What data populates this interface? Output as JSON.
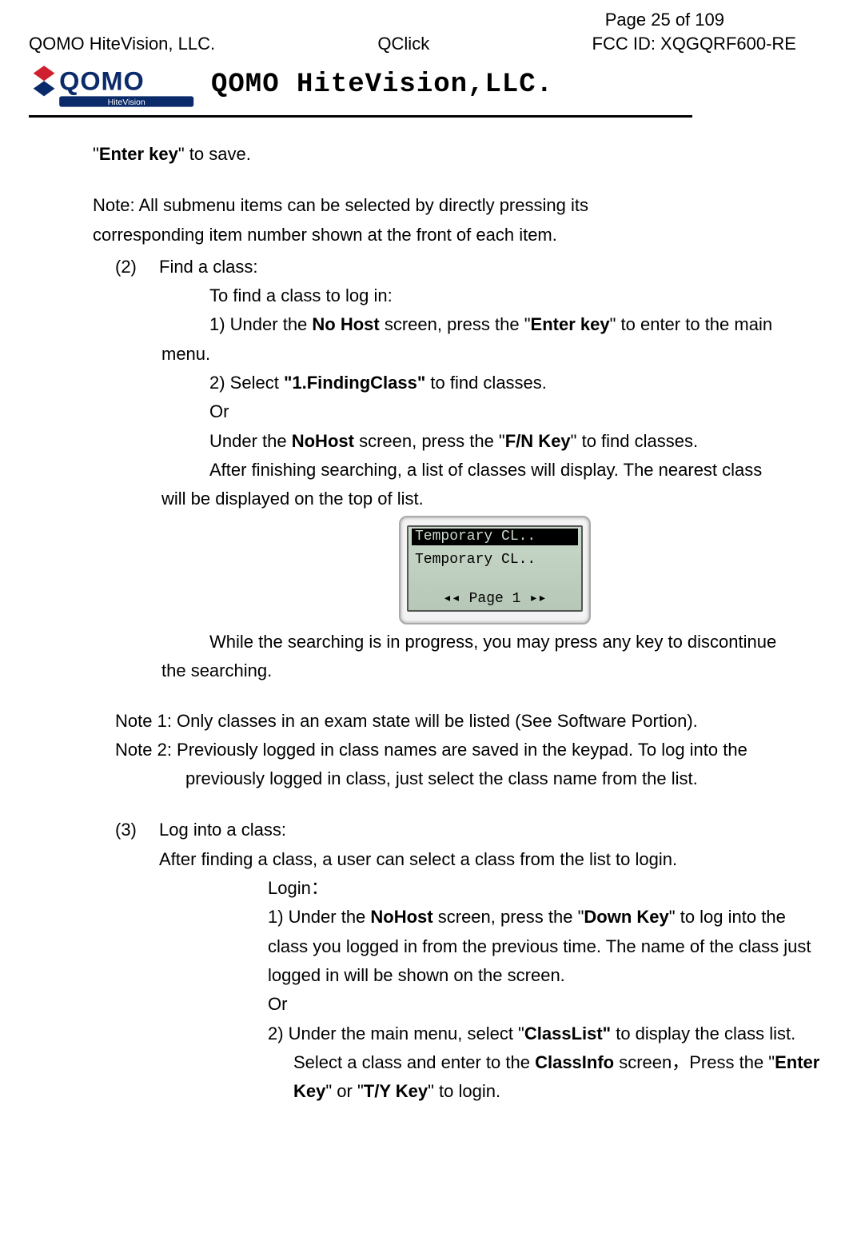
{
  "page_number_label": "Page 25 of 109",
  "header": {
    "left": "QOMO HiteVision, LLC.",
    "center": "QClick",
    "right": "FCC ID: XQGQRF600-RE"
  },
  "brand_title": "QOMO HiteVision,LLC.",
  "first_line_pre": "\"",
  "first_line_bold": "Enter key",
  "first_line_post": "\" to save.",
  "note_line1": "Note: All submenu items can be selected by directly pressing its",
  "note_line2": "corresponding item number shown at the front of each item.",
  "section2_num": "(2)",
  "section2_title": "Find a class:",
  "s2_l1": "To find a class to log in:",
  "s2_l2_a": "1) Under the ",
  "s2_l2_b": "No Host",
  "s2_l2_c": " screen, press the \"",
  "s2_l2_d": "Enter key",
  "s2_l2_e": "\" to enter to the main",
  "s2_l3": "menu.",
  "s2_l4_a": "2) Select ",
  "s2_l4_b": "\"1.FindingClass\"",
  "s2_l4_c": " to find classes.",
  "s2_l5": "Or",
  "s2_l6_a": "Under the ",
  "s2_l6_b": "NoHost",
  "s2_l6_c": " screen, press the \"",
  "s2_l6_d": "F/N Key",
  "s2_l6_e": "\" to find classes.",
  "s2_l7": "After finishing searching, a list of classes will display. The nearest class",
  "s2_l8": "will be displayed on the top of list.",
  "lcd": {
    "row1": "Temporary CL..",
    "row2": "Temporary CL..",
    "page": "◂◂   Page 1   ▸▸"
  },
  "s2_l9": "While the searching is in progress, you may press any key to discontinue",
  "s2_l10": "the searching.",
  "note1": "Note 1: Only classes in an exam state will be listed (See Software Portion).",
  "note2a": "Note 2: Previously logged in class names are saved in the keypad.    To log into the",
  "note2b": "previously logged in class, just select the class name from the list.",
  "section3_num": "(3)",
  "section3_title": "Log into a class:",
  "s3_l1": "After finding a class, a user can select a class from the list to login.",
  "s3_login": "Login：",
  "s3_step1_a": "1)    Under the ",
  "s3_step1_b": "NoHost",
  "s3_step1_c": " screen, press the \"",
  "s3_step1_d": "Down Key",
  "s3_step1_e": "\" to log into the",
  "s3_step1_f": "class you logged in from the previous time. The name of the class just",
  "s3_step1_g": "logged in will be shown on the screen.",
  "s3_or": "Or",
  "s3_step2_a": "2)    Under the main menu, select \"",
  "s3_step2_b": "ClassList\"",
  "s3_step2_c": " to display the class list.",
  "s3_step2_d_a": "Select a class and enter to the ",
  "s3_step2_d_b": "ClassInfo",
  "s3_step2_d_c": " screen，Press the \"",
  "s3_step2_d_d": "Enter",
  "s3_step2_e_a": "Key",
  "s3_step2_e_b": "\" or \"",
  "s3_step2_e_c": "T/Y Key",
  "s3_step2_e_d": "\" to login."
}
